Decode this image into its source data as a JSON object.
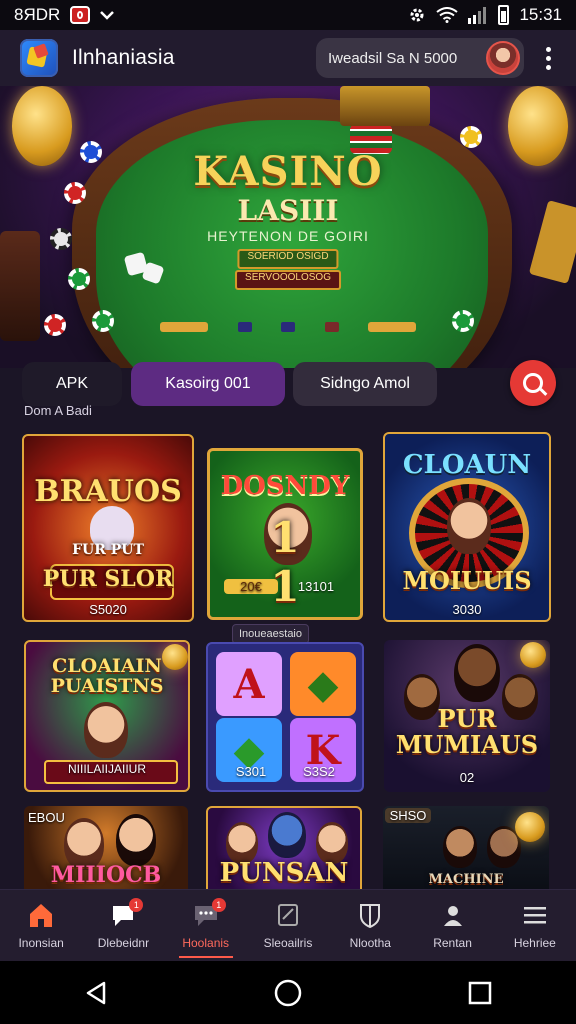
{
  "status_bar": {
    "left_text": "8ЯDR",
    "time": "15:31",
    "icons": [
      "app-badge-icon",
      "chevron-down-icon",
      "gear-icon",
      "wifi-icon",
      "signal-icon",
      "battery-icon"
    ]
  },
  "app_bar": {
    "title": "Ilnhaniasia",
    "search_text": "Iweadsil Sa N 5000",
    "menu_icon": "more-vert-icon"
  },
  "hero": {
    "title": "KASINO",
    "subtitle": "LASIII",
    "line": "HEYTENON DE GOIRI",
    "tag1": "SOERIOD OSIGD",
    "tag2": "SERVOOOLOSOG"
  },
  "filters": {
    "items": [
      {
        "label": "APK"
      },
      {
        "label": "Kasoirg 001"
      },
      {
        "label": "Sidngo Amol"
      }
    ],
    "search_icon": "search-icon"
  },
  "section_label": "Dom A Badi",
  "games": [
    {
      "title": "BRAUOS",
      "subtitle": "PUR SLOR",
      "line": "FUR  PUT",
      "price": "S5020"
    },
    {
      "title": "DOSNDY",
      "subtitle": "1   1",
      "line": "20€",
      "price": "13101"
    },
    {
      "title": "CLOAUN",
      "subtitle": "MOIUUIS",
      "price": "3030"
    },
    {
      "title": "CLOAIAIN PUAISTNS",
      "subtitle": "NIIILAIIJAIIUR"
    },
    {
      "title": "A",
      "subtitle": "K",
      "price": "S301",
      "price2": "S3S2"
    },
    {
      "title": "PUR MUMIAUS",
      "price": "02"
    },
    {
      "title": "MIIIOCB",
      "corner": "EBOU"
    },
    {
      "title": "PUNSAN"
    },
    {
      "title": "MACHINE",
      "corner": "SHSO"
    }
  ],
  "game_tag": "Inoueaestaio",
  "bottom_nav": [
    {
      "label": "Inonsian",
      "icon": "home-icon"
    },
    {
      "label": "Dlebeidnr",
      "icon": "chat-icon",
      "badge": "1"
    },
    {
      "label": "Hoolanis",
      "icon": "message-icon",
      "badge": "1",
      "active": true
    },
    {
      "label": "Sleoailris",
      "icon": "cards-icon"
    },
    {
      "label": "Nlootha",
      "icon": "shield-icon"
    },
    {
      "label": "Rentan",
      "icon": "user-icon"
    },
    {
      "label": "Hehriee",
      "icon": "menu-icon"
    }
  ],
  "system_nav": [
    "back-icon",
    "home-circle-icon",
    "recents-icon"
  ],
  "colors": {
    "accent": "#e53935",
    "active_chip": "#5d2b82",
    "background": "#1b1526"
  }
}
